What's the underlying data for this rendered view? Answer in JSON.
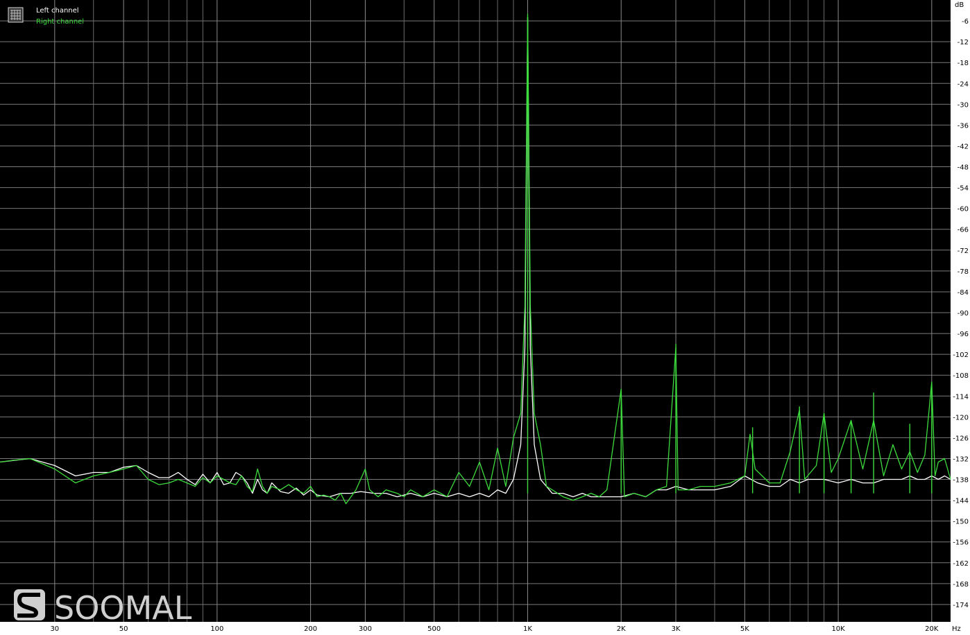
{
  "legend": {
    "items": [
      {
        "label": "Left channel",
        "color": "#ffffff"
      },
      {
        "label": "Right channel",
        "color": "#3ddc3d"
      }
    ],
    "icon": "spectrum-grid-icon",
    "placement": "top-left"
  },
  "watermark": {
    "text": "SOOMAL"
  },
  "chart_data": {
    "type": "line",
    "title": "",
    "xlabel": "",
    "ylabel": "",
    "x_unit_label": "Hz",
    "y_unit_label": "dB",
    "x_scale": "log",
    "xlim": [
      20,
      23000
    ],
    "ylim": [
      -179,
      0
    ],
    "grid": true,
    "y_ticks": [
      -6,
      -12,
      -18,
      -24,
      -30,
      -36,
      -42,
      -48,
      -54,
      -60,
      -66,
      -72,
      -78,
      -84,
      -90,
      -96,
      -102,
      -108,
      -114,
      -120,
      -126,
      -132,
      -138,
      -144,
      -150,
      -156,
      -162,
      -168,
      -174
    ],
    "x_ticks": [
      {
        "value": 30,
        "label": "30"
      },
      {
        "value": 50,
        "label": "50"
      },
      {
        "value": 100,
        "label": "100"
      },
      {
        "value": 200,
        "label": "200"
      },
      {
        "value": 300,
        "label": "300"
      },
      {
        "value": 500,
        "label": "500"
      },
      {
        "value": 1000,
        "label": "1K"
      },
      {
        "value": 2000,
        "label": "2K"
      },
      {
        "value": 3000,
        "label": "3K"
      },
      {
        "value": 5000,
        "label": "5K"
      },
      {
        "value": 10000,
        "label": "10K"
      },
      {
        "value": 20000,
        "label": "20K"
      }
    ],
    "x_minor_grid": [
      40,
      60,
      70,
      80,
      90,
      400,
      600,
      700,
      800,
      900,
      4000,
      6000,
      7000,
      8000,
      9000
    ],
    "series": [
      {
        "name": "Left channel",
        "color": "#ffffff",
        "points": [
          [
            20,
            -133
          ],
          [
            25,
            -132
          ],
          [
            30,
            -134
          ],
          [
            35,
            -137
          ],
          [
            40,
            -136
          ],
          [
            45,
            -136
          ],
          [
            50,
            -134.5
          ],
          [
            55,
            -134
          ],
          [
            60,
            -136
          ],
          [
            65,
            -137.5
          ],
          [
            70,
            -137.5
          ],
          [
            75,
            -136
          ],
          [
            80,
            -138
          ],
          [
            85,
            -139.5
          ],
          [
            90,
            -136.5
          ],
          [
            95,
            -139
          ],
          [
            100,
            -136
          ],
          [
            105,
            -139.5
          ],
          [
            110,
            -139
          ],
          [
            115,
            -136
          ],
          [
            120,
            -137
          ],
          [
            125,
            -139
          ],
          [
            130,
            -142
          ],
          [
            135,
            -138
          ],
          [
            140,
            -141
          ],
          [
            145,
            -142
          ],
          [
            150,
            -139
          ],
          [
            160,
            -141.5
          ],
          [
            170,
            -142
          ],
          [
            180,
            -140.5
          ],
          [
            190,
            -142.5
          ],
          [
            200,
            -141
          ],
          [
            210,
            -142.5
          ],
          [
            230,
            -143
          ],
          [
            250,
            -142
          ],
          [
            270,
            -142
          ],
          [
            290,
            -141.5
          ],
          [
            320,
            -142
          ],
          [
            350,
            -142
          ],
          [
            380,
            -143
          ],
          [
            420,
            -142
          ],
          [
            460,
            -143
          ],
          [
            500,
            -142
          ],
          [
            550,
            -143
          ],
          [
            600,
            -142
          ],
          [
            650,
            -143
          ],
          [
            700,
            -142
          ],
          [
            750,
            -143
          ],
          [
            800,
            -141
          ],
          [
            850,
            -142
          ],
          [
            900,
            -138
          ],
          [
            950,
            -128
          ],
          [
            980,
            -100
          ],
          [
            1000,
            -5
          ],
          [
            1020,
            -100
          ],
          [
            1050,
            -128
          ],
          [
            1100,
            -138
          ],
          [
            1200,
            -142
          ],
          [
            1300,
            -142
          ],
          [
            1400,
            -143
          ],
          [
            1500,
            -142
          ],
          [
            1600,
            -143
          ],
          [
            1800,
            -143
          ],
          [
            2000,
            -143
          ],
          [
            2200,
            -142
          ],
          [
            2400,
            -143
          ],
          [
            2600,
            -141
          ],
          [
            2800,
            -141
          ],
          [
            3000,
            -140
          ],
          [
            3300,
            -141
          ],
          [
            3600,
            -141
          ],
          [
            4000,
            -141
          ],
          [
            4500,
            -140
          ],
          [
            5000,
            -137
          ],
          [
            5500,
            -139
          ],
          [
            6000,
            -140
          ],
          [
            6500,
            -140
          ],
          [
            7000,
            -138
          ],
          [
            7500,
            -139
          ],
          [
            8000,
            -138
          ],
          [
            9000,
            -138
          ],
          [
            10000,
            -139
          ],
          [
            11000,
            -138
          ],
          [
            12000,
            -139
          ],
          [
            13000,
            -139
          ],
          [
            14000,
            -138
          ],
          [
            15000,
            -138
          ],
          [
            16000,
            -138
          ],
          [
            17000,
            -137
          ],
          [
            18000,
            -138
          ],
          [
            19000,
            -138
          ],
          [
            20000,
            -137
          ],
          [
            21000,
            -138
          ],
          [
            22000,
            -137
          ],
          [
            23000,
            -138
          ]
        ]
      },
      {
        "name": "Right channel",
        "color": "#3ddc3d",
        "points": [
          [
            20,
            -133
          ],
          [
            22,
            -132.5
          ],
          [
            25,
            -132
          ],
          [
            30,
            -135
          ],
          [
            35,
            -139
          ],
          [
            40,
            -137
          ],
          [
            45,
            -136
          ],
          [
            50,
            -135
          ],
          [
            55,
            -134
          ],
          [
            60,
            -138
          ],
          [
            65,
            -139.5
          ],
          [
            70,
            -139
          ],
          [
            75,
            -138
          ],
          [
            80,
            -139
          ],
          [
            85,
            -140
          ],
          [
            90,
            -137.5
          ],
          [
            95,
            -139
          ],
          [
            100,
            -137
          ],
          [
            105,
            -138
          ],
          [
            110,
            -139
          ],
          [
            115,
            -139.5
          ],
          [
            120,
            -137
          ],
          [
            125,
            -140
          ],
          [
            130,
            -141.5
          ],
          [
            135,
            -135
          ],
          [
            140,
            -140
          ],
          [
            145,
            -142
          ],
          [
            150,
            -140
          ],
          [
            160,
            -141
          ],
          [
            170,
            -139.5
          ],
          [
            180,
            -141
          ],
          [
            190,
            -142
          ],
          [
            200,
            -140
          ],
          [
            210,
            -143
          ],
          [
            220,
            -142.5
          ],
          [
            230,
            -143
          ],
          [
            240,
            -144
          ],
          [
            250,
            -142
          ],
          [
            260,
            -145
          ],
          [
            270,
            -143
          ],
          [
            280,
            -141
          ],
          [
            300,
            -135
          ],
          [
            310,
            -141
          ],
          [
            330,
            -143
          ],
          [
            350,
            -141
          ],
          [
            380,
            -142
          ],
          [
            400,
            -143
          ],
          [
            420,
            -141
          ],
          [
            460,
            -143
          ],
          [
            500,
            -141
          ],
          [
            550,
            -143
          ],
          [
            600,
            -136
          ],
          [
            650,
            -140
          ],
          [
            700,
            -133
          ],
          [
            750,
            -141
          ],
          [
            800,
            -129
          ],
          [
            850,
            -140
          ],
          [
            900,
            -126
          ],
          [
            950,
            -119
          ],
          [
            980,
            -88
          ],
          [
            1000,
            -4
          ],
          [
            1020,
            -88
          ],
          [
            1050,
            -119
          ],
          [
            1100,
            -128
          ],
          [
            1150,
            -140
          ],
          [
            1200,
            -141
          ],
          [
            1300,
            -143
          ],
          [
            1400,
            -144
          ],
          [
            1500,
            -143
          ],
          [
            1600,
            -142
          ],
          [
            1700,
            -143
          ],
          [
            1800,
            -141
          ],
          [
            2000,
            -112
          ],
          [
            2050,
            -143
          ],
          [
            2200,
            -142
          ],
          [
            2400,
            -143
          ],
          [
            2600,
            -141
          ],
          [
            2800,
            -140
          ],
          [
            3000,
            -100
          ],
          [
            3050,
            -141
          ],
          [
            3300,
            -141
          ],
          [
            3600,
            -140
          ],
          [
            4000,
            -140
          ],
          [
            4500,
            -139
          ],
          [
            5000,
            -137
          ],
          [
            5200,
            -125
          ],
          [
            5400,
            -135
          ],
          [
            6000,
            -139
          ],
          [
            6500,
            -139
          ],
          [
            7000,
            -130
          ],
          [
            7500,
            -118
          ],
          [
            7800,
            -138
          ],
          [
            8500,
            -134
          ],
          [
            9000,
            -119
          ],
          [
            9500,
            -136
          ],
          [
            10000,
            -132
          ],
          [
            11000,
            -121
          ],
          [
            12000,
            -135
          ],
          [
            13000,
            -121
          ],
          [
            14000,
            -137
          ],
          [
            15000,
            -128
          ],
          [
            16000,
            -135
          ],
          [
            17000,
            -130
          ],
          [
            18000,
            -136
          ],
          [
            19000,
            -131
          ],
          [
            20000,
            -110
          ],
          [
            20500,
            -137
          ],
          [
            21000,
            -133
          ],
          [
            22000,
            -132
          ],
          [
            23000,
            -138
          ]
        ],
        "peaks": [
          [
            1000,
            -5
          ],
          [
            2000,
            -113
          ],
          [
            3000,
            -99
          ],
          [
            5300,
            -123
          ],
          [
            7500,
            -117
          ],
          [
            9000,
            -119
          ],
          [
            11000,
            -121
          ],
          [
            13000,
            -113
          ],
          [
            17000,
            -122
          ],
          [
            20000,
            -110
          ]
        ]
      }
    ]
  }
}
